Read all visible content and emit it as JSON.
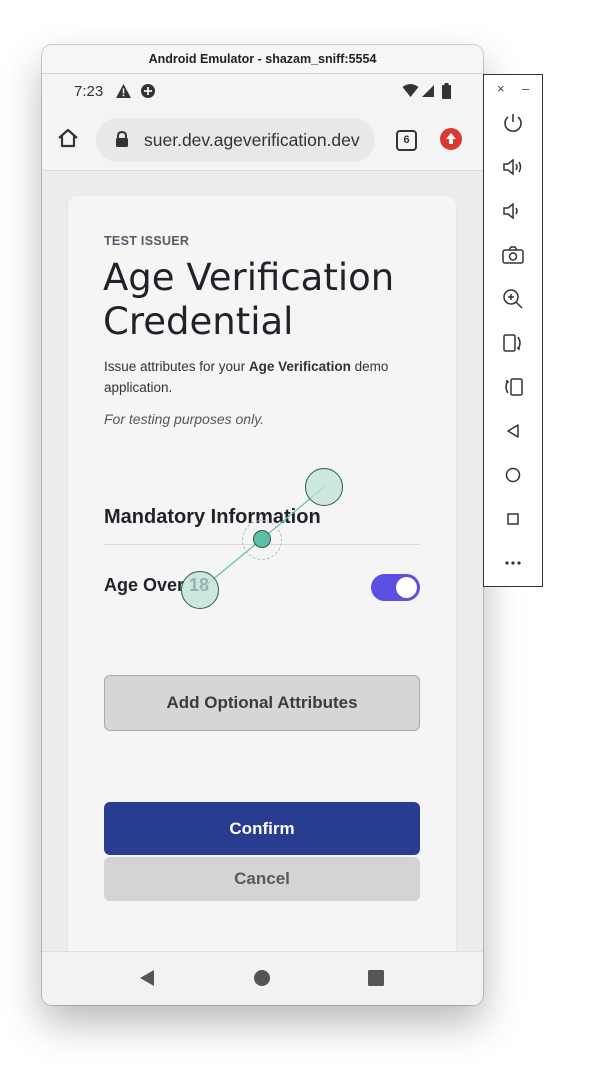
{
  "window": {
    "title": "Android Emulator - shazam_sniff:5554"
  },
  "statusbar": {
    "time": "7:23"
  },
  "browser": {
    "url": "suer.dev.ageverification.dev",
    "tab_count": "6"
  },
  "page": {
    "overline": "TEST ISSUER",
    "title": "Age Verification Credential",
    "desc_prefix": "Issue attributes for your ",
    "desc_bold": "Age Verification",
    "desc_suffix": " demo application.",
    "note": "For testing purposes only.",
    "section_title": "Mandatory Information",
    "attribute_label": "Age Over 18",
    "attribute_enabled": true,
    "optional_button": "Add Optional Attributes",
    "confirm_button": "Confirm",
    "cancel_button": "Cancel"
  },
  "colors": {
    "primary": "#283d8f",
    "toggle": "#5b50e3",
    "alert_badge": "#d93a2f"
  },
  "icons": {
    "statusbar": [
      "warning-icon",
      "data-saver-icon",
      "wifi-icon",
      "signal-icon",
      "battery-icon"
    ],
    "toolbar": [
      "power-icon",
      "volume-up-icon",
      "volume-down-icon",
      "camera-icon",
      "zoom-icon",
      "rotate-left-icon",
      "rotate-right-icon",
      "back-icon",
      "home-icon",
      "overview-icon",
      "more-icon"
    ]
  }
}
